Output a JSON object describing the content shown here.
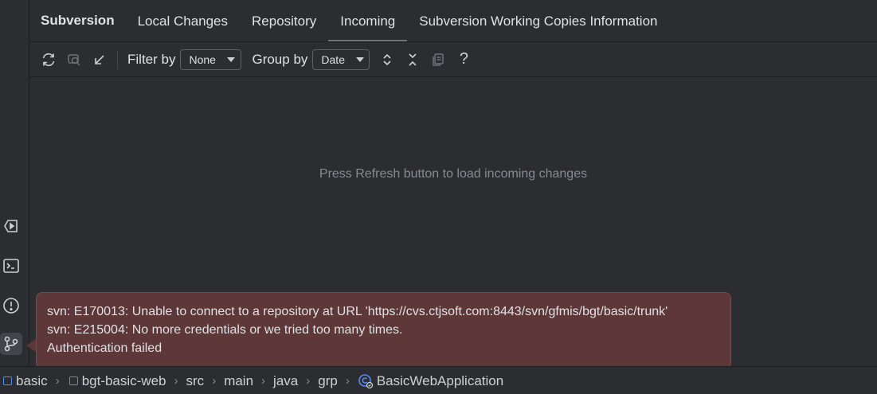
{
  "tool_window": {
    "title": "Subversion",
    "tabs": [
      {
        "label": "Local Changes"
      },
      {
        "label": "Repository"
      },
      {
        "label": "Incoming"
      },
      {
        "label": "Subversion Working Copies Information"
      }
    ],
    "selected_tab": "Incoming"
  },
  "toolbar": {
    "filter_label": "Filter by",
    "filter_value": "None",
    "group_label": "Group by",
    "group_value": "Date",
    "help_label": "?"
  },
  "main": {
    "empty_message": "Press Refresh button to load incoming changes"
  },
  "error": {
    "lines": [
      "svn: E170013: Unable to connect to a repository at URL 'https://cvs.ctjsoft.com:8443/svn/gfmis/bgt/basic/trunk'",
      "svn: E215004: No more credentials or we tried too many times.",
      "Authentication failed"
    ]
  },
  "breadcrumb": {
    "items": [
      "basic",
      "bgt-basic-web",
      "src",
      "main",
      "java",
      "grp",
      "BasicWebApplication"
    ]
  },
  "colors": {
    "background": "#2b2d30",
    "error_background": "#5e3838",
    "module_icon": "#548af7"
  }
}
